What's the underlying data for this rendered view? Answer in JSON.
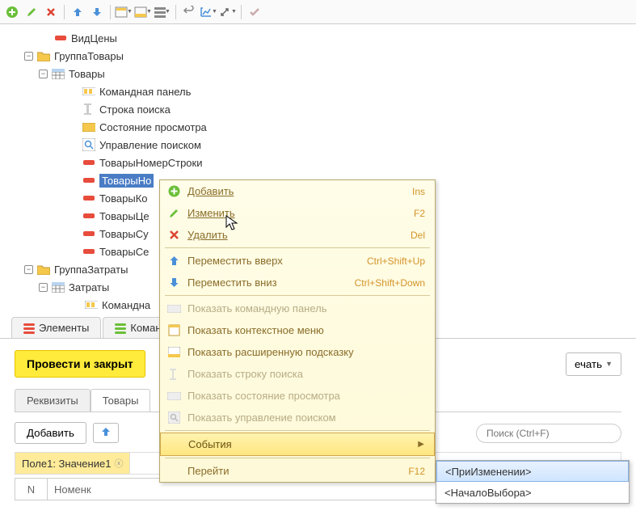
{
  "toolbar": {},
  "tree": {
    "n0": "ВидЦены",
    "n1": "ГруппаТовары",
    "n2": "Товары",
    "n3": "Командная панель",
    "n4": "Строка поиска",
    "n5": "Состояние просмотра",
    "n6": "Управление поиском",
    "n7": "ТоварыНомерСтроки",
    "n8": "ТоварыНо",
    "n9": "ТоварыКо",
    "n10": "ТоварыЦе",
    "n11": "ТоварыСу",
    "n12": "ТоварыСе",
    "n13": "ГруппаЗатраты",
    "n14": "Затраты",
    "n15": "Командна"
  },
  "tabs": {
    "elements": "Элементы",
    "comm": "Коман"
  },
  "main": {
    "conduct": "Провести и закрыт",
    "print": "ечать"
  },
  "sub_tabs": {
    "req": "Реквизиты",
    "goods": "Товары"
  },
  "add_button": "Добавить",
  "search_placeholder": "Поиск (Ctrl+F)",
  "field_row": "Поле1: Значение1",
  "th": {
    "n": "N",
    "nom": "Номенк"
  },
  "menu": {
    "add": "Добавить",
    "add_key": "Ins",
    "edit": "Изменить",
    "edit_key": "F2",
    "del": "Удалить",
    "del_key": "Del",
    "up": "Переместить вверх",
    "up_key": "Ctrl+Shift+Up",
    "down": "Переместить вниз",
    "down_key": "Ctrl+Shift+Down",
    "show_cmd": "Показать командную панель",
    "show_ctx": "Показать контекстное меню",
    "show_hint": "Показать расширенную подсказку",
    "show_search": "Показать строку поиска",
    "show_view": "Показать состояние просмотра",
    "show_mgmt": "Показать управление поиском",
    "events": "События",
    "goto": "Перейти",
    "goto_key": "F12"
  },
  "submenu": {
    "onchange": "<ПриИзменении>",
    "onstart": "<НачалоВыбора>"
  }
}
